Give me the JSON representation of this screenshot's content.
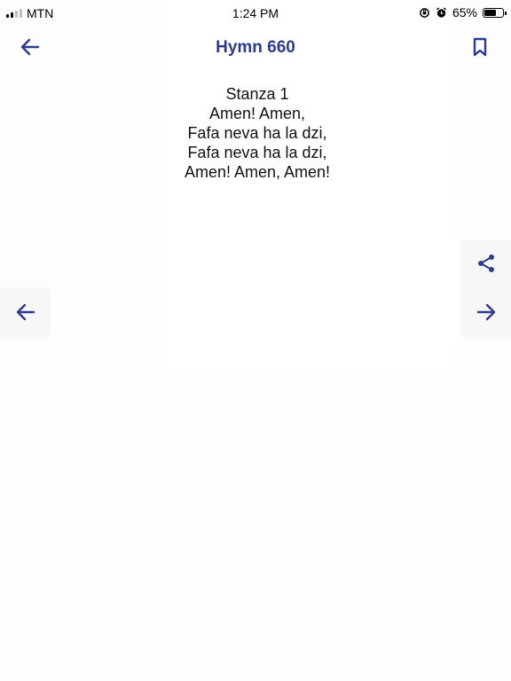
{
  "status_bar": {
    "carrier": "MTN",
    "time": "1:24 PM",
    "battery_percent": "65%",
    "battery_level": 0.65,
    "signal_bars": 2
  },
  "header": {
    "title": "Hymn 660",
    "back_icon": "arrow-left-icon",
    "bookmark_icon": "bookmark-icon"
  },
  "lyrics": {
    "stanza_label": "Stanza 1",
    "lines": [
      "Amen! Amen,",
      "Fafa neva ha la dzi,",
      "Fafa neva ha la dzi,",
      "Amen! Amen, Amen!"
    ]
  },
  "side_controls": {
    "share_icon": "share-icon",
    "next_icon": "arrow-right-icon",
    "previous_icon": "arrow-left-icon"
  },
  "colors": {
    "accent": "#2e3a8c",
    "background": "#fdfdfd",
    "side_button_bg": "#f7f7f7"
  }
}
